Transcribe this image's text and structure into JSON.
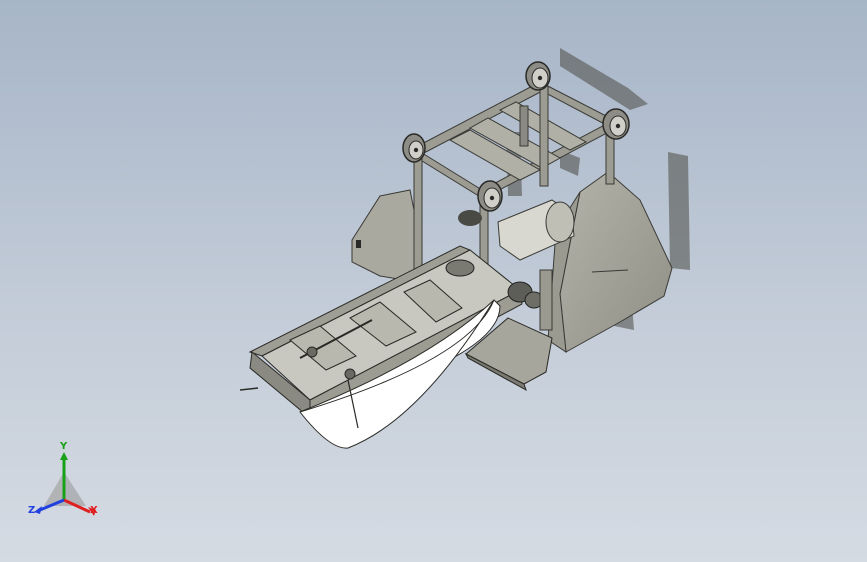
{
  "viewport": {
    "background_top": "#a7b5c8",
    "background_bottom": "#d5dbe3"
  },
  "model": {
    "frame_color": "#8a8a82",
    "panel_color": "#a4a49a",
    "shadow_color": "#6a6a62",
    "chute_color": "#ffffff"
  },
  "triad": {
    "x_label": "X",
    "y_label": "Y",
    "z_label": "Z",
    "x_color": "#e02020",
    "y_color": "#18a018",
    "z_color": "#2040e0"
  }
}
